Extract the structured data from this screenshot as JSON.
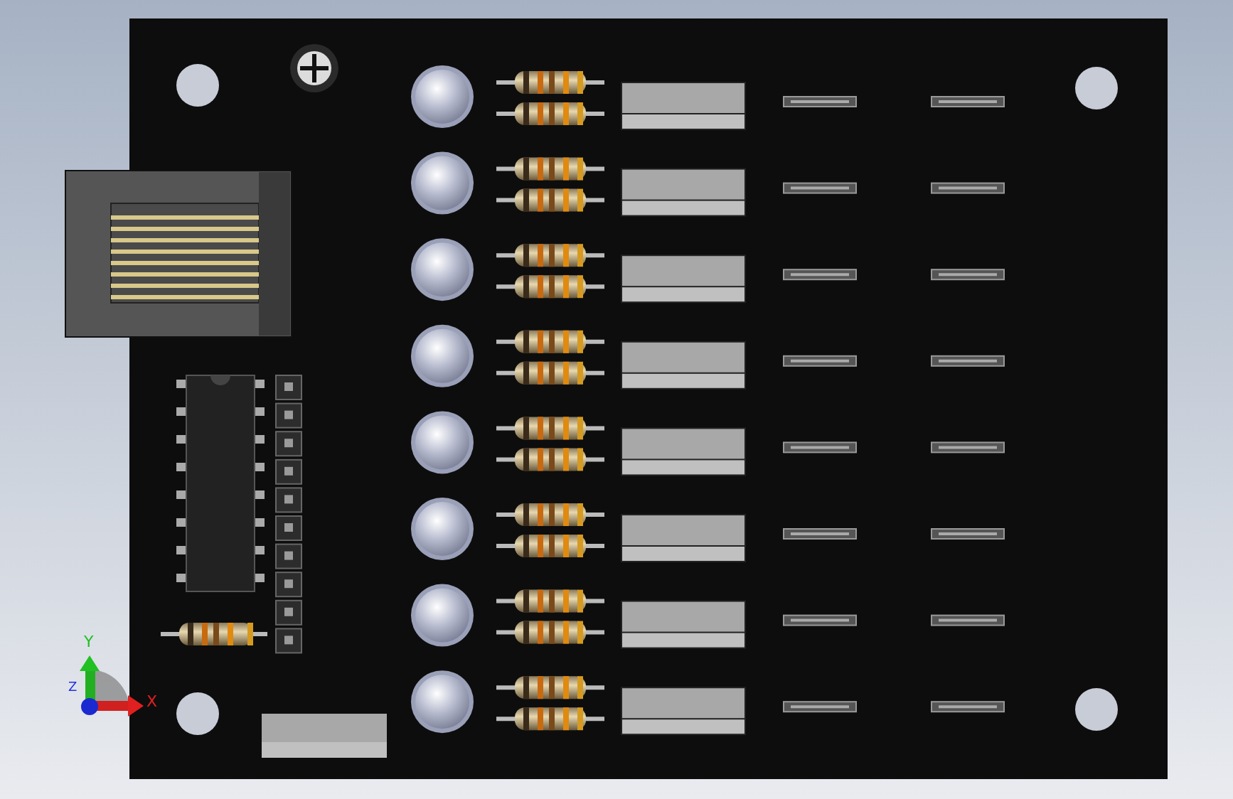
{
  "triad": {
    "y_label": "Y",
    "z_label": "Z",
    "x_label": "X"
  }
}
